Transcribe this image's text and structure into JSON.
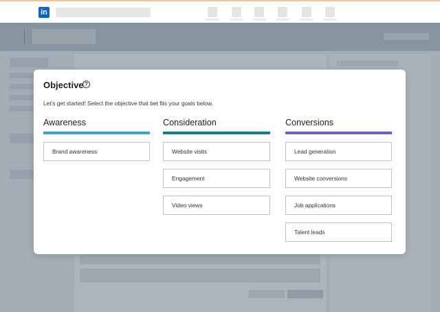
{
  "topbar": {
    "logo_text": "in",
    "logo_color": "#0a66c2"
  },
  "modal": {
    "title": "Objective",
    "help_icon": "?",
    "intro": "Let's get started! Select the objective that bet fits your goals below.",
    "columns": [
      {
        "title": "Awareness",
        "bar_color": "#3aa3d6",
        "options": [
          "Brand awareness"
        ]
      },
      {
        "title": "Consideration",
        "bar_color": "#177e86",
        "options": [
          "Website visits",
          "Engagement",
          "Video views"
        ]
      },
      {
        "title": "Conversions",
        "bar_color": "#6b5bd6",
        "options": [
          "Lead generation",
          "Website conversions",
          "Job applications",
          "Talent leads"
        ]
      }
    ]
  }
}
